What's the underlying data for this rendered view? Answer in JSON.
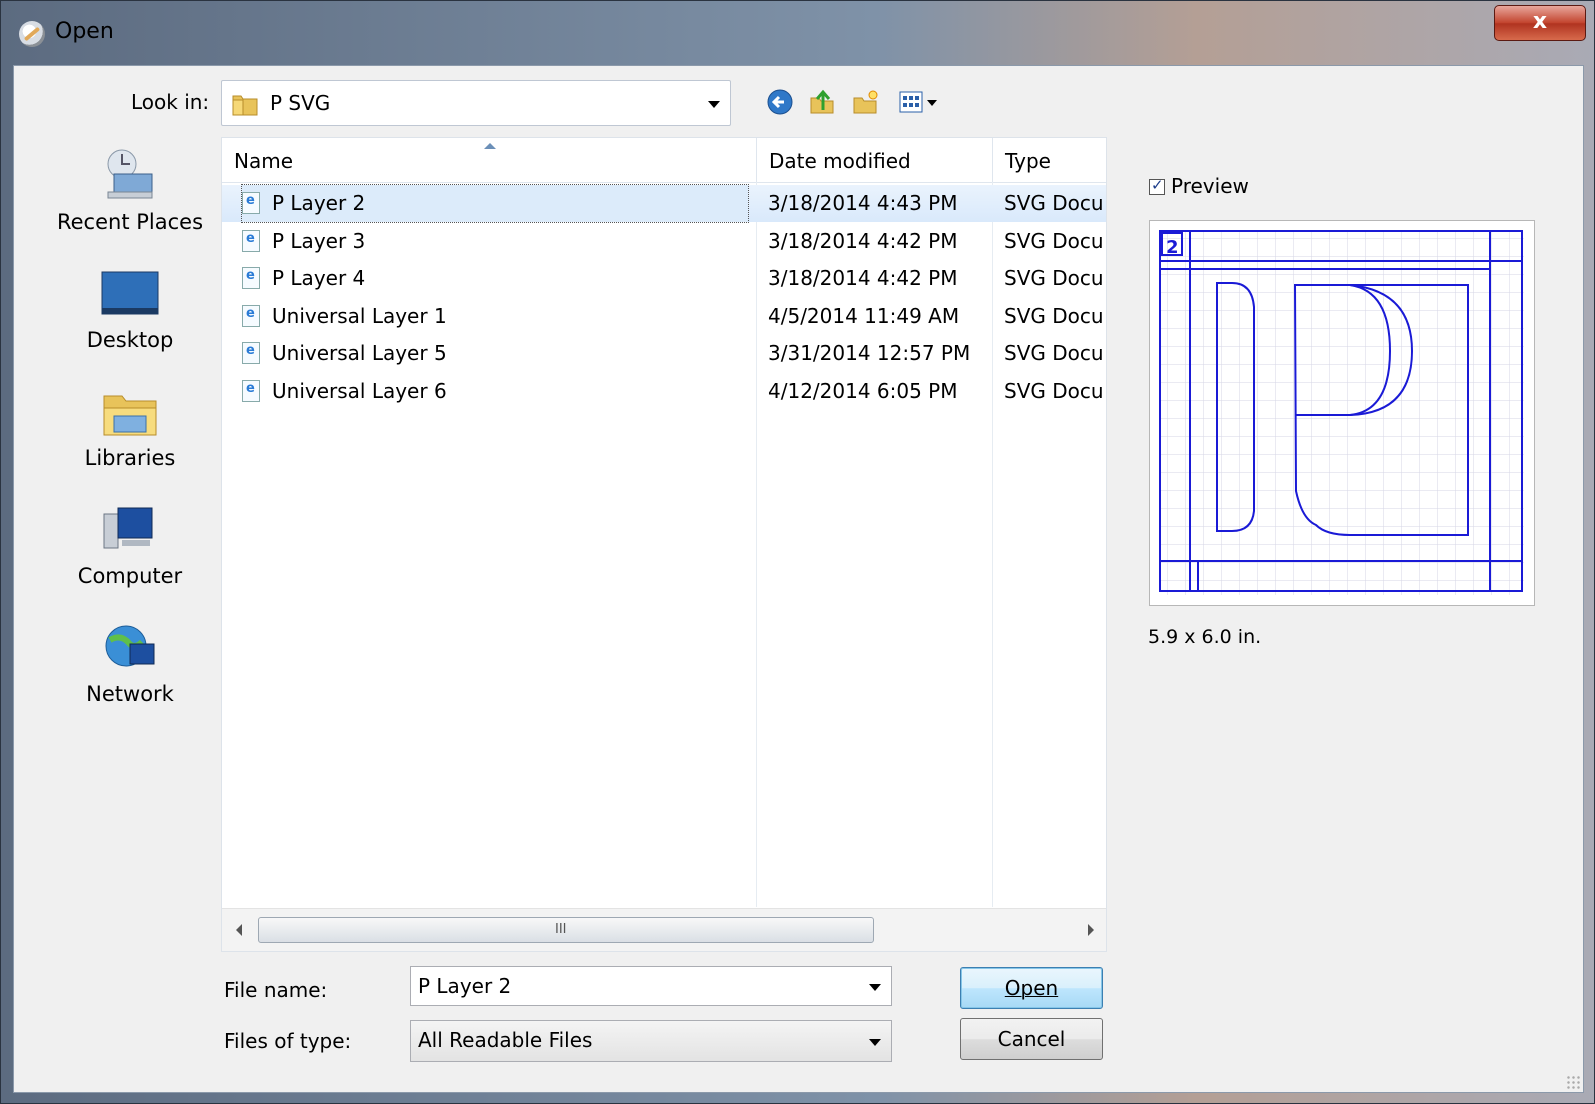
{
  "window": {
    "title": "Open",
    "close_glyph": "x"
  },
  "toolbar": {
    "lookin_label": "Look in:",
    "lookin_value": "P SVG",
    "icons": [
      "back-icon",
      "up-folder-icon",
      "new-folder-icon",
      "view-menu-icon"
    ]
  },
  "places": [
    {
      "label": "Recent Places",
      "icon": "recent-places-icon"
    },
    {
      "label": "Desktop",
      "icon": "desktop-icon"
    },
    {
      "label": "Libraries",
      "icon": "libraries-icon"
    },
    {
      "label": "Computer",
      "icon": "computer-icon"
    },
    {
      "label": "Network",
      "icon": "network-icon"
    }
  ],
  "columns": {
    "name": "Name",
    "date": "Date modified",
    "type": "Type"
  },
  "files": [
    {
      "name": "P Layer 2",
      "date": "3/18/2014 4:43 PM",
      "type": "SVG Docu"
    },
    {
      "name": "P Layer 3",
      "date": "3/18/2014 4:42 PM",
      "type": "SVG Docu"
    },
    {
      "name": "P Layer 4",
      "date": "3/18/2014 4:42 PM",
      "type": "SVG Docu"
    },
    {
      "name": "Universal Layer 1",
      "date": "4/5/2014 11:49 AM",
      "type": "SVG Docu"
    },
    {
      "name": "Universal Layer 5",
      "date": "3/31/2014 12:57 PM",
      "type": "SVG Docu"
    },
    {
      "name": "Universal Layer 6",
      "date": "4/12/2014 6:05 PM",
      "type": "SVG Docu"
    }
  ],
  "selected_index": 0,
  "preview": {
    "checkbox_label": "Preview",
    "checked": true,
    "size_text": "5.9 x 6.0 in.",
    "badge": "2"
  },
  "form": {
    "filename_label": "File name:",
    "filename_value": "P Layer 2",
    "filetype_label": "Files of type:",
    "filetype_value": "All Readable Files",
    "open_label": "Open",
    "cancel_label": "Cancel"
  },
  "scrollbar": {
    "thumb_grip": "III"
  },
  "colors": {
    "selection": "#dcebfa",
    "preview_lines": "#1a1ad6",
    "accent": "#3c7fb1"
  }
}
